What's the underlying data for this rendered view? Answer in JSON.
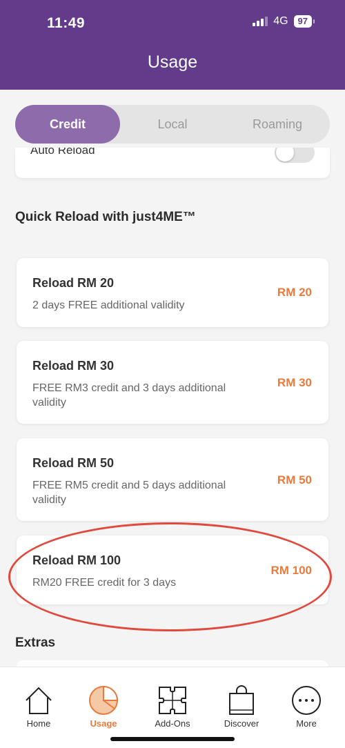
{
  "status_bar": {
    "time": "11:49",
    "network": "4G",
    "battery": "97"
  },
  "header": {
    "title": "Usage"
  },
  "tabs": [
    {
      "label": "Credit",
      "active": true
    },
    {
      "label": "Local",
      "active": false
    },
    {
      "label": "Roaming",
      "active": false
    }
  ],
  "auto_reload": {
    "label": "Auto Reload",
    "enabled": false
  },
  "quick_reload": {
    "title": "Quick Reload with just4ME™",
    "items": [
      {
        "title": "Reload RM 20",
        "description": "2 days FREE additional validity",
        "price": "RM 20"
      },
      {
        "title": "Reload RM 30",
        "description": "FREE RM3 credit and 3 days additional validity",
        "price": "RM 30"
      },
      {
        "title": "Reload RM 50",
        "description": "FREE RM5 credit and 5 days additional validity",
        "price": "RM 50"
      },
      {
        "title": "Reload RM 100",
        "description": "RM20 FREE credit for 3 days",
        "price": "RM 100"
      }
    ]
  },
  "extras": {
    "title": "Extras"
  },
  "bottom_nav": [
    {
      "label": "Home",
      "icon": "home-icon"
    },
    {
      "label": "Usage",
      "icon": "pie-chart-icon",
      "active": true
    },
    {
      "label": "Add-Ons",
      "icon": "puzzle-icon"
    },
    {
      "label": "Discover",
      "icon": "shopping-bag-icon"
    },
    {
      "label": "More",
      "icon": "more-icon"
    }
  ],
  "colors": {
    "header": "#623c8a",
    "accent": "#8e6bab",
    "price": "#e87b3c",
    "highlight": "#e0493c"
  }
}
